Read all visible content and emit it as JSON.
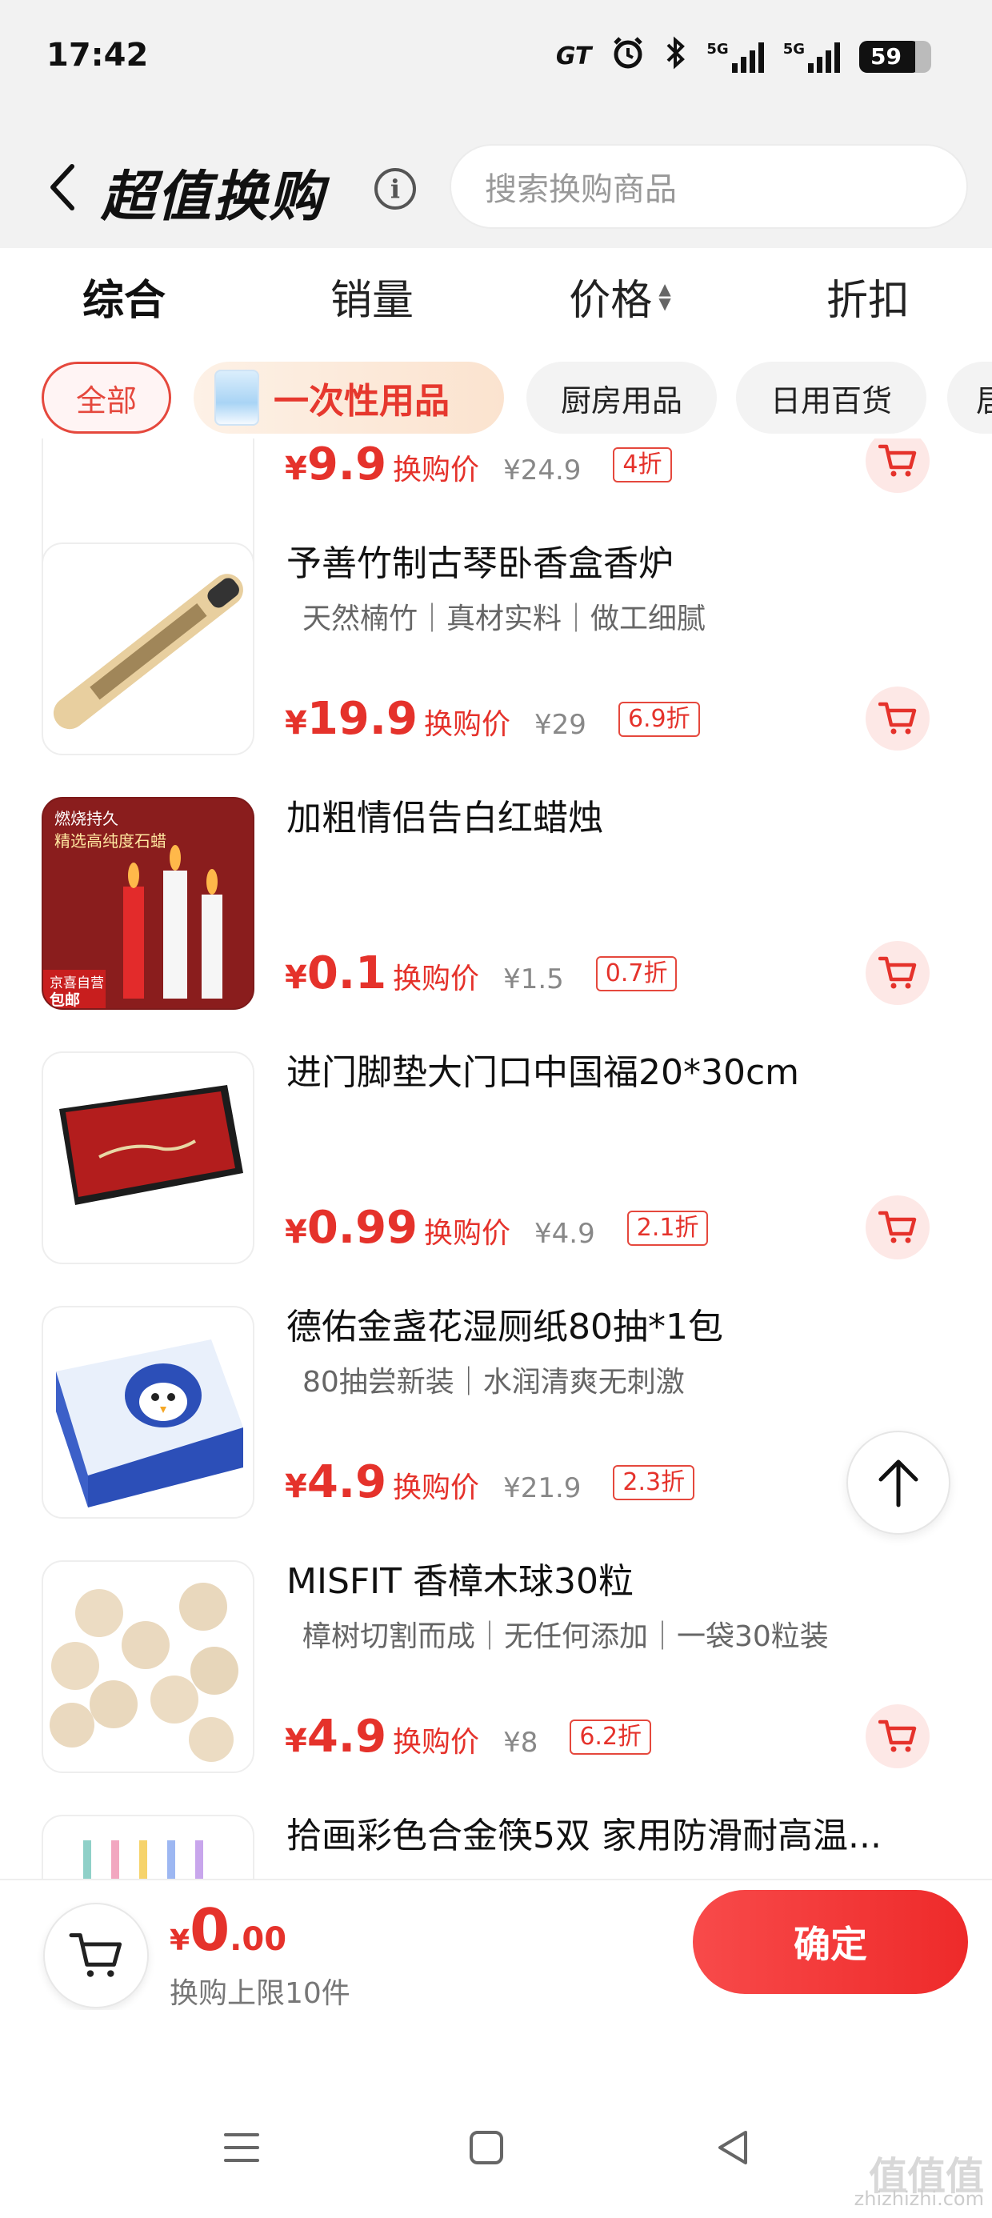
{
  "status_bar": {
    "time": "17:42",
    "gt_label": "GT",
    "net_label_1": "5G",
    "net_label_2": "5G",
    "battery": "59",
    "icons": [
      "gt-icon",
      "alarm-icon",
      "bluetooth-icon",
      "signal-icon",
      "signal-icon",
      "battery-icon"
    ]
  },
  "header": {
    "title": "超值换购",
    "search_placeholder": "搜索换购商品"
  },
  "sort_tabs": [
    {
      "label": "综合",
      "active": true
    },
    {
      "label": "销量",
      "active": false
    },
    {
      "label": "价格",
      "active": false
    },
    {
      "label": "折扣",
      "active": false
    }
  ],
  "chips": [
    {
      "label": "全部",
      "active": true
    },
    {
      "label": "一次性用品",
      "promo": true
    },
    {
      "label": "厨房用品"
    },
    {
      "label": "日用百货"
    },
    {
      "label": "居"
    }
  ],
  "products": [
    {
      "title": "",
      "tags": "",
      "yen": "¥",
      "price": "9.9",
      "price_label": "换购价",
      "original_price": "¥24.9",
      "discount": "4折"
    },
    {
      "title": "予善竹制古琴卧香盒香炉",
      "tags": "天然楠竹｜真材实料｜做工细腻",
      "yen": "¥",
      "price": "19.9",
      "price_label": "换购价",
      "original_price": "¥29",
      "discount": "6.9折"
    },
    {
      "title": "加粗情侣告白红蜡烛",
      "tags": "",
      "yen": "¥",
      "price": "0.1",
      "price_label": "换购价",
      "original_price": "¥1.5",
      "discount": "0.7折",
      "thumb_text": {
        "line1": "燃烧持久",
        "line2": "精选高纯度石蜡",
        "badge1": "京喜自营",
        "badge2": "包邮"
      }
    },
    {
      "title": "进门脚垫大门口中国福20*30cm",
      "tags": "",
      "yen": "¥",
      "price": "0.99",
      "price_label": "换购价",
      "original_price": "¥4.9",
      "discount": "2.1折"
    },
    {
      "title": "德佑金盏花湿厕纸80抽*1包",
      "tags": "80抽尝新装｜水润清爽无刺激",
      "yen": "¥",
      "price": "4.9",
      "price_label": "换购价",
      "original_price": "¥21.9",
      "discount": "2.3折"
    },
    {
      "title": "MISFIT 香樟木球30粒",
      "tags": "樟树切割而成｜无任何添加｜一袋30粒装",
      "yen": "¥",
      "price": "4.9",
      "price_label": "换购价",
      "original_price": "¥8",
      "discount": "6.2折"
    },
    {
      "title": "拾画彩色合金筷5双 家用防滑耐高温...",
      "tags": "",
      "yen": "",
      "price": "",
      "price_label": "",
      "original_price": "",
      "discount": ""
    }
  ],
  "bottom_bar": {
    "yen": "¥",
    "total_int": "0",
    "total_dec": ".00",
    "limit_text": "换购上限10件",
    "confirm_label": "确定"
  },
  "watermark": {
    "big": "值值值",
    "small": "zhizhizhi.com"
  },
  "colors": {
    "accent": "#e5322b",
    "header_bg": "#f2f2f2",
    "cart_bg": "#fde8e6"
  }
}
